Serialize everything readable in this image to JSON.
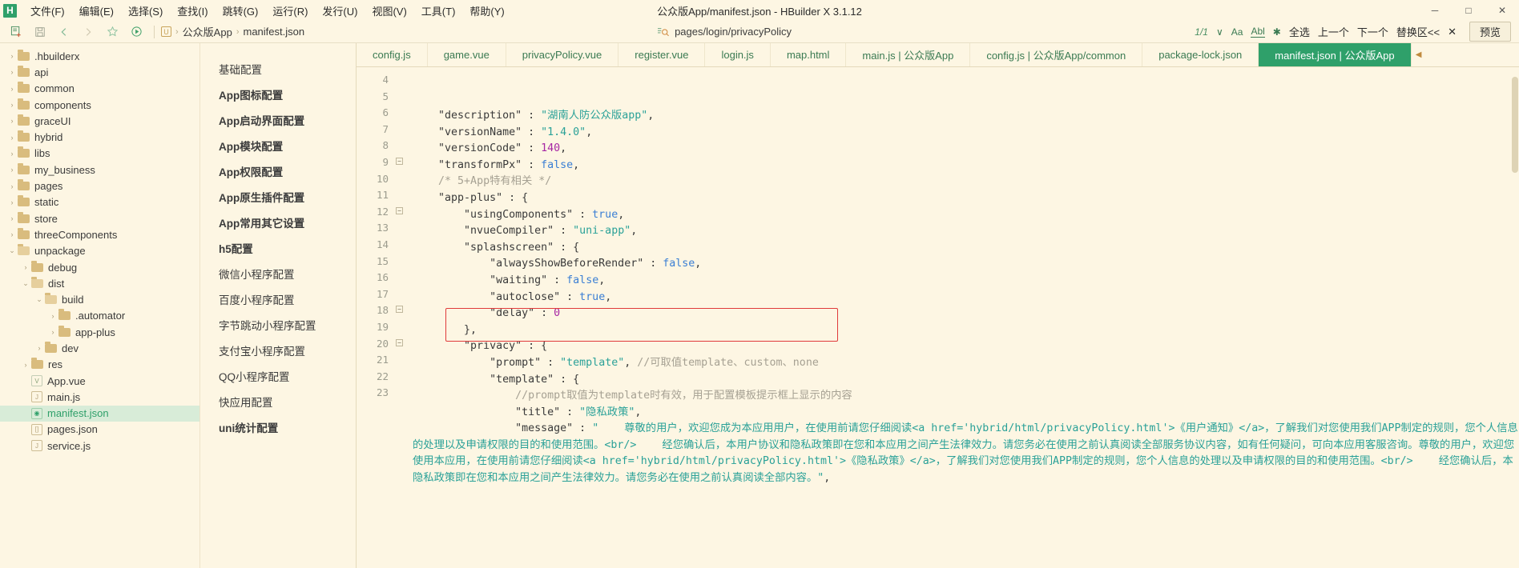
{
  "window": {
    "title": "公众版App/manifest.json - HBuilder X 3.1.12",
    "logo": "H",
    "minimize": "─",
    "maximize": "□",
    "close": "✕"
  },
  "menubar": {
    "items": [
      {
        "label": "文件(F)"
      },
      {
        "label": "编辑(E)"
      },
      {
        "label": "选择(S)"
      },
      {
        "label": "查找(I)"
      },
      {
        "label": "跳转(G)"
      },
      {
        "label": "运行(R)"
      },
      {
        "label": "发行(U)"
      },
      {
        "label": "视图(V)"
      },
      {
        "label": "工具(T)"
      },
      {
        "label": "帮助(Y)"
      }
    ]
  },
  "toolbar": {
    "icons": [
      {
        "name": "new-file-icon",
        "glyph": "⧉"
      },
      {
        "name": "save-icon",
        "glyph": "Ὃe"
      },
      {
        "name": "back-icon",
        "glyph": "‹"
      },
      {
        "name": "forward-icon",
        "glyph": "›"
      },
      {
        "name": "bookmark-icon",
        "glyph": "☆"
      },
      {
        "name": "run-icon",
        "glyph": "▶"
      }
    ],
    "breadcrumb": {
      "project_icon": "U",
      "project": "公众版App",
      "separator": "›",
      "file": "manifest.json"
    },
    "find": {
      "icon": "⌕",
      "value": "pages/login/privacyPolicy",
      "placeholder": "查找"
    },
    "right": {
      "match_count": "1/1",
      "chevron": "∨",
      "case_label": "Aa",
      "word_label": "Abl",
      "regex_label": "✱",
      "select_all": "全选",
      "prev": "上一个",
      "next": "下一个",
      "replace_area": "替换区<<",
      "close": "✕",
      "preview": "预览"
    }
  },
  "sidebar": {
    "items": [
      {
        "label": ".hbuilderx",
        "type": "folder",
        "depth": 0,
        "expanded": false,
        "selected": false
      },
      {
        "label": "api",
        "type": "folder",
        "depth": 0,
        "expanded": false,
        "selected": false
      },
      {
        "label": "common",
        "type": "folder",
        "depth": 0,
        "expanded": false,
        "selected": false
      },
      {
        "label": "components",
        "type": "folder",
        "depth": 0,
        "expanded": false,
        "selected": false
      },
      {
        "label": "graceUI",
        "type": "folder",
        "depth": 0,
        "expanded": false,
        "selected": false
      },
      {
        "label": "hybrid",
        "type": "folder",
        "depth": 0,
        "expanded": false,
        "selected": false
      },
      {
        "label": "libs",
        "type": "folder",
        "depth": 0,
        "expanded": false,
        "selected": false
      },
      {
        "label": "my_business",
        "type": "folder",
        "depth": 0,
        "expanded": false,
        "selected": false
      },
      {
        "label": "pages",
        "type": "folder",
        "depth": 0,
        "expanded": false,
        "selected": false
      },
      {
        "label": "static",
        "type": "folder",
        "depth": 0,
        "expanded": false,
        "selected": false
      },
      {
        "label": "store",
        "type": "folder",
        "depth": 0,
        "expanded": false,
        "selected": false
      },
      {
        "label": "threeComponents",
        "type": "folder",
        "depth": 0,
        "expanded": false,
        "selected": false
      },
      {
        "label": "unpackage",
        "type": "folder",
        "depth": 0,
        "expanded": true,
        "selected": false
      },
      {
        "label": "debug",
        "type": "folder",
        "depth": 1,
        "expanded": false,
        "selected": false
      },
      {
        "label": "dist",
        "type": "folder",
        "depth": 1,
        "expanded": true,
        "selected": false
      },
      {
        "label": "build",
        "type": "folder",
        "depth": 2,
        "expanded": true,
        "selected": false
      },
      {
        "label": ".automator",
        "type": "folder",
        "depth": 3,
        "expanded": false,
        "selected": false
      },
      {
        "label": "app-plus",
        "type": "folder",
        "depth": 3,
        "expanded": false,
        "selected": false
      },
      {
        "label": "dev",
        "type": "folder",
        "depth": 2,
        "expanded": false,
        "selected": false
      },
      {
        "label": "res",
        "type": "folder",
        "depth": 1,
        "expanded": false,
        "selected": false
      },
      {
        "label": "App.vue",
        "type": "vue",
        "depth": 1,
        "expanded": false,
        "selected": false,
        "icon": "V"
      },
      {
        "label": "main.js",
        "type": "file",
        "depth": 1,
        "expanded": false,
        "selected": false,
        "icon": "J"
      },
      {
        "label": "manifest.json",
        "type": "manifest",
        "depth": 1,
        "expanded": false,
        "selected": true,
        "icon": "◉"
      },
      {
        "label": "pages.json",
        "type": "file",
        "depth": 1,
        "expanded": false,
        "selected": false,
        "icon": "[]"
      },
      {
        "label": "service.js",
        "type": "file",
        "depth": 1,
        "expanded": false,
        "selected": false,
        "icon": "J"
      }
    ]
  },
  "config_nav": {
    "items": [
      {
        "label": "基础配置",
        "bold": false
      },
      {
        "label": "App图标配置",
        "bold": true
      },
      {
        "label": "App启动界面配置",
        "bold": true
      },
      {
        "label": "App模块配置",
        "bold": true
      },
      {
        "label": "App权限配置",
        "bold": true
      },
      {
        "label": "App原生插件配置",
        "bold": true
      },
      {
        "label": "App常用其它设置",
        "bold": true
      },
      {
        "label": "h5配置",
        "bold": true
      },
      {
        "label": "微信小程序配置",
        "bold": false
      },
      {
        "label": "百度小程序配置",
        "bold": false
      },
      {
        "label": "字节跳动小程序配置",
        "bold": false
      },
      {
        "label": "支付宝小程序配置",
        "bold": false
      },
      {
        "label": "QQ小程序配置",
        "bold": false
      },
      {
        "label": "快应用配置",
        "bold": false
      },
      {
        "label": "uni统计配置",
        "bold": true
      }
    ]
  },
  "tabs": [
    {
      "label": "config.js",
      "active": false
    },
    {
      "label": "game.vue",
      "active": false
    },
    {
      "label": "privacyPolicy.vue",
      "active": false
    },
    {
      "label": "register.vue",
      "active": false
    },
    {
      "label": "login.js",
      "active": false
    },
    {
      "label": "map.html",
      "active": false
    },
    {
      "label": "main.js | 公众版App",
      "active": false
    },
    {
      "label": "config.js | 公众版App/common",
      "active": false
    },
    {
      "label": "package-lock.json",
      "active": false
    },
    {
      "label": "manifest.json | 公众版App",
      "active": true
    }
  ],
  "editor": {
    "first_line": 4,
    "line_numbers": [
      4,
      5,
      6,
      7,
      8,
      9,
      10,
      11,
      12,
      13,
      14,
      15,
      16,
      17,
      18,
      19,
      20,
      21,
      22,
      23
    ],
    "fold_lines": [
      9,
      12,
      18,
      20
    ],
    "lines": [
      {
        "n": 4,
        "tokens": [
          {
            "t": "    ",
            "c": "p"
          },
          {
            "t": "\"description\"",
            "c": "k"
          },
          {
            "t": " : ",
            "c": "p"
          },
          {
            "t": "\"湖南人防公众版app\"",
            "c": "str"
          },
          {
            "t": ",",
            "c": "p"
          }
        ]
      },
      {
        "n": 5,
        "tokens": [
          {
            "t": "    ",
            "c": "p"
          },
          {
            "t": "\"versionName\"",
            "c": "k"
          },
          {
            "t": " : ",
            "c": "p"
          },
          {
            "t": "\"1.4.0\"",
            "c": "str"
          },
          {
            "t": ",",
            "c": "p"
          }
        ]
      },
      {
        "n": 6,
        "tokens": [
          {
            "t": "    ",
            "c": "p"
          },
          {
            "t": "\"versionCode\"",
            "c": "k"
          },
          {
            "t": " : ",
            "c": "p"
          },
          {
            "t": "140",
            "c": "num"
          },
          {
            "t": ",",
            "c": "p"
          }
        ]
      },
      {
        "n": 7,
        "tokens": [
          {
            "t": "    ",
            "c": "p"
          },
          {
            "t": "\"transformPx\"",
            "c": "k"
          },
          {
            "t": " : ",
            "c": "p"
          },
          {
            "t": "false",
            "c": "bool"
          },
          {
            "t": ",",
            "c": "p"
          }
        ]
      },
      {
        "n": 8,
        "tokens": [
          {
            "t": "    ",
            "c": "p"
          },
          {
            "t": "/* 5+App特有相关 */",
            "c": "cmt"
          }
        ]
      },
      {
        "n": 9,
        "tokens": [
          {
            "t": "    ",
            "c": "p"
          },
          {
            "t": "\"app-plus\"",
            "c": "k"
          },
          {
            "t": " : {",
            "c": "p"
          }
        ]
      },
      {
        "n": 10,
        "tokens": [
          {
            "t": "        ",
            "c": "p"
          },
          {
            "t": "\"usingComponents\"",
            "c": "k"
          },
          {
            "t": " : ",
            "c": "p"
          },
          {
            "t": "true",
            "c": "bool"
          },
          {
            "t": ",",
            "c": "p"
          }
        ]
      },
      {
        "n": 11,
        "tokens": [
          {
            "t": "        ",
            "c": "p"
          },
          {
            "t": "\"nvueCompiler\"",
            "c": "k"
          },
          {
            "t": " : ",
            "c": "p"
          },
          {
            "t": "\"uni-app\"",
            "c": "str"
          },
          {
            "t": ",",
            "c": "p"
          }
        ]
      },
      {
        "n": 12,
        "tokens": [
          {
            "t": "        ",
            "c": "p"
          },
          {
            "t": "\"splashscreen\"",
            "c": "k"
          },
          {
            "t": " : {",
            "c": "p"
          }
        ]
      },
      {
        "n": 13,
        "tokens": [
          {
            "t": "            ",
            "c": "p"
          },
          {
            "t": "\"alwaysShowBeforeRender\"",
            "c": "k"
          },
          {
            "t": " : ",
            "c": "p"
          },
          {
            "t": "false",
            "c": "bool"
          },
          {
            "t": ",",
            "c": "p"
          }
        ]
      },
      {
        "n": 14,
        "tokens": [
          {
            "t": "            ",
            "c": "p"
          },
          {
            "t": "\"waiting\"",
            "c": "k"
          },
          {
            "t": " : ",
            "c": "p"
          },
          {
            "t": "false",
            "c": "bool"
          },
          {
            "t": ",",
            "c": "p"
          }
        ]
      },
      {
        "n": 15,
        "tokens": [
          {
            "t": "            ",
            "c": "p"
          },
          {
            "t": "\"autoclose\"",
            "c": "k"
          },
          {
            "t": " : ",
            "c": "p"
          },
          {
            "t": "true",
            "c": "bool"
          },
          {
            "t": ",",
            "c": "p"
          }
        ]
      },
      {
        "n": 16,
        "tokens": [
          {
            "t": "            ",
            "c": "p"
          },
          {
            "t": "\"delay\"",
            "c": "k"
          },
          {
            "t": " : ",
            "c": "p"
          },
          {
            "t": "0",
            "c": "num"
          }
        ]
      },
      {
        "n": 17,
        "tokens": [
          {
            "t": "        },",
            "c": "p"
          }
        ]
      },
      {
        "n": 18,
        "tokens": [
          {
            "t": "        ",
            "c": "p"
          },
          {
            "t": "\"privacy\"",
            "c": "k"
          },
          {
            "t": " : {",
            "c": "p"
          }
        ]
      },
      {
        "n": 19,
        "tokens": [
          {
            "t": "            ",
            "c": "p"
          },
          {
            "t": "\"prompt\"",
            "c": "k"
          },
          {
            "t": " : ",
            "c": "p"
          },
          {
            "t": "\"template\"",
            "c": "str"
          },
          {
            "t": ", ",
            "c": "p"
          },
          {
            "t": "//可取值template、custom、none",
            "c": "cmt"
          }
        ]
      },
      {
        "n": 20,
        "tokens": [
          {
            "t": "            ",
            "c": "p"
          },
          {
            "t": "\"template\"",
            "c": "k"
          },
          {
            "t": " : {",
            "c": "p"
          }
        ]
      },
      {
        "n": 21,
        "tokens": [
          {
            "t": "                ",
            "c": "p"
          },
          {
            "t": "//prompt取值为template时有效，用于配置模板提示框上显示的内容",
            "c": "cmt"
          }
        ]
      },
      {
        "n": 22,
        "tokens": [
          {
            "t": "                ",
            "c": "p"
          },
          {
            "t": "\"title\"",
            "c": "k"
          },
          {
            "t": " : ",
            "c": "p"
          },
          {
            "t": "\"隐私政策\"",
            "c": "str"
          },
          {
            "t": ",",
            "c": "p"
          }
        ]
      },
      {
        "n": 23,
        "tokens": [
          {
            "t": "                ",
            "c": "p"
          },
          {
            "t": "\"message\"",
            "c": "k"
          },
          {
            "t": " : ",
            "c": "p"
          },
          {
            "t": "\"    尊敬的用户，欢迎您成为本应用用户，在使用前请您仔细阅读<a href='hybrid/html/privacyPolicy.html'>《用户通知》</a>，了解我们对您使用我们APP制定的规则，您个人信息的处理以及申请权限的目的和使用范围。<br/>    经您确认后，本用户协议和隐私政策即在您和本应用之间产生法律效力。请您务必在使用之前认真阅读全部服务协议内容，如有任何疑问，可向本应用客服咨询。尊敬的用户，欢迎您使用本应用，在使用前请您仔细阅读<a href='hybrid/html/privacyPolicy.html'>《隐私政策》</a>，了解我们对您使用我们APP制定的规则，您个人信息的处理以及申请权限的目的和使用范围。<br/>    经您确认后，本隐私政策即在您和本应用之间产生法律效力。请您务必在使用之前认真阅读全部内容。\"",
            "c": "str"
          },
          {
            "t": ",",
            "c": "p"
          }
        ]
      }
    ]
  },
  "colors": {
    "accent": "#2fa06a",
    "background": "#fdf6e3",
    "highlight_box": "#e03a3a",
    "selection": "#d8ecd8"
  }
}
